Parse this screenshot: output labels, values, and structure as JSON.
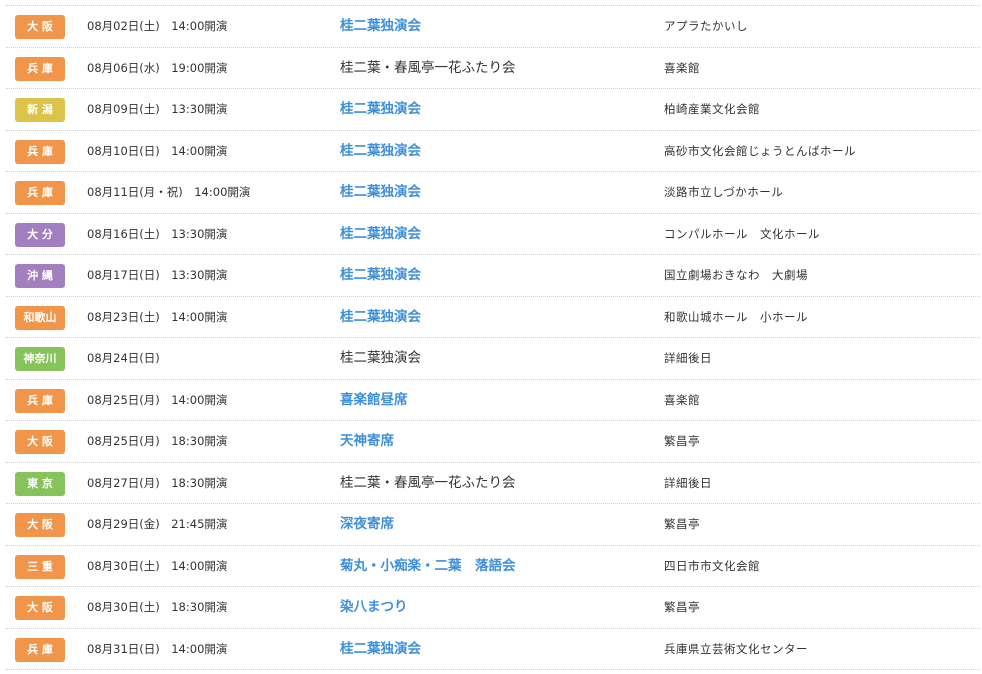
{
  "colors": {
    "orange": "#f0954a",
    "yellow": "#dcc44a",
    "purple": "#a47fc0",
    "green": "#86c35a",
    "link": "#3f8fd9"
  },
  "events": [
    {
      "region": "大 阪",
      "color": "orange",
      "date": "08月02日(土)　14:00開演",
      "title": "桂二葉独演会",
      "link": true,
      "venue": "アプラたかいし"
    },
    {
      "region": "兵 庫",
      "color": "orange",
      "date": "08月06日(水)　19:00開演",
      "title": "桂二葉・春風亭一花ふたり会",
      "link": false,
      "venue": "喜楽館"
    },
    {
      "region": "新 潟",
      "color": "yellow",
      "date": "08月09日(土)　13:30開演",
      "title": "桂二葉独演会",
      "link": true,
      "venue": "柏崎産業文化会館"
    },
    {
      "region": "兵 庫",
      "color": "orange",
      "date": "08月10日(日)　14:00開演",
      "title": "桂二葉独演会",
      "link": true,
      "venue": "高砂市文化会館じょうとんばホール"
    },
    {
      "region": "兵 庫",
      "color": "orange",
      "date": "08月11日(月・祝)　14:00開演",
      "title": "桂二葉独演会",
      "link": true,
      "venue": "淡路市立しづかホール"
    },
    {
      "region": "大 分",
      "color": "purple",
      "date": "08月16日(土)　13:30開演",
      "title": "桂二葉独演会",
      "link": true,
      "venue": "コンパルホール　文化ホール"
    },
    {
      "region": "沖 縄",
      "color": "purple",
      "date": "08月17日(日)　13:30開演",
      "title": "桂二葉独演会",
      "link": true,
      "venue": "国立劇場おきなわ　大劇場"
    },
    {
      "region": "和歌山",
      "color": "orange",
      "date": "08月23日(土)　14:00開演",
      "title": "桂二葉独演会",
      "link": true,
      "venue": "和歌山城ホール　小ホール"
    },
    {
      "region": "神奈川",
      "color": "green",
      "date": "08月24日(日)",
      "title": "桂二葉独演会",
      "link": false,
      "venue": "詳細後日"
    },
    {
      "region": "兵 庫",
      "color": "orange",
      "date": "08月25日(月)　14:00開演",
      "title": "喜楽館昼席",
      "link": true,
      "venue": "喜楽館"
    },
    {
      "region": "大 阪",
      "color": "orange",
      "date": "08月25日(月)　18:30開演",
      "title": "天神寄席",
      "link": true,
      "venue": "繁昌亭"
    },
    {
      "region": "東 京",
      "color": "green",
      "date": "08月27日(月)　18:30開演",
      "title": "桂二葉・春風亭一花ふたり会",
      "link": false,
      "venue": "詳細後日"
    },
    {
      "region": "大 阪",
      "color": "orange",
      "date": "08月29日(金)　21:45開演",
      "title": "深夜寄席",
      "link": true,
      "venue": "繁昌亭"
    },
    {
      "region": "三 重",
      "color": "orange",
      "date": "08月30日(土)　14:00開演",
      "title": "菊丸・小痴楽・二葉　落語会",
      "link": true,
      "venue": "四日市市文化会館"
    },
    {
      "region": "大 阪",
      "color": "orange",
      "date": "08月30日(土)　18:30開演",
      "title": "染八まつり",
      "link": true,
      "venue": "繁昌亭"
    },
    {
      "region": "兵 庫",
      "color": "orange",
      "date": "08月31日(日)　14:00開演",
      "title": "桂二葉独演会",
      "link": true,
      "venue": "兵庫県立芸術文化センター"
    }
  ]
}
